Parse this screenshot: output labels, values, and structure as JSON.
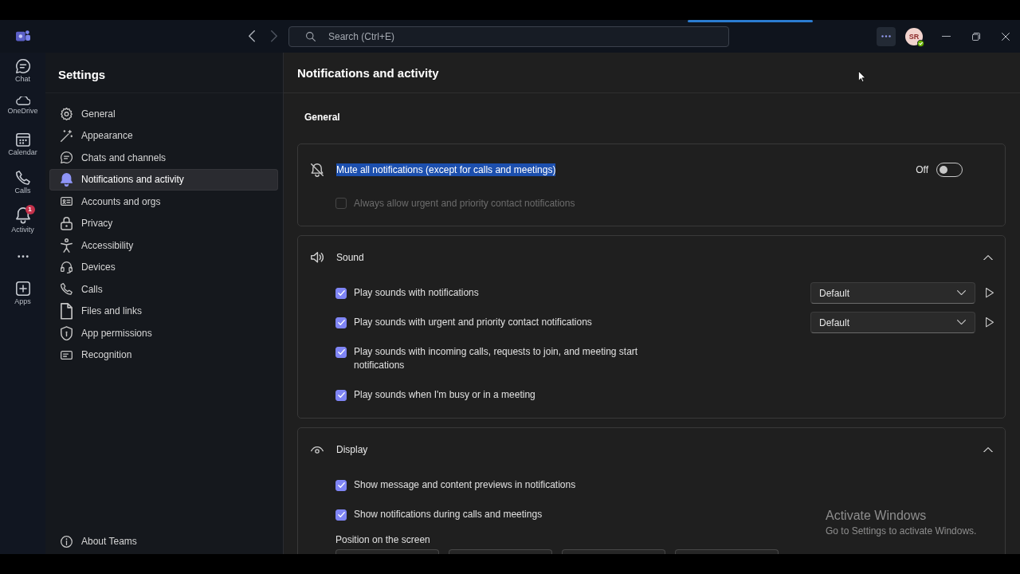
{
  "title_bar": {
    "navigation": {
      "back_disabled": false,
      "forward_disabled": true
    },
    "search": {
      "placeholder": "Search (Ctrl+E)"
    },
    "avatar": {
      "initials": "SR",
      "available": true
    }
  },
  "app_rail": [
    {
      "kind": "app",
      "label": "Chat"
    },
    {
      "kind": "app",
      "label": "OneDrive"
    },
    {
      "kind": "app",
      "label": "Calendar"
    },
    {
      "kind": "app",
      "label": "Calls"
    },
    {
      "kind": "app",
      "label": "Activity",
      "badge": "1"
    },
    {
      "kind": "more"
    },
    {
      "kind": "app",
      "label": "Apps"
    }
  ],
  "settings": {
    "title": "Settings",
    "items": [
      {
        "label": "General",
        "selected": false
      },
      {
        "label": "Appearance",
        "selected": false
      },
      {
        "label": "Chats and channels",
        "selected": false
      },
      {
        "label": "Notifications and activity",
        "selected": true
      },
      {
        "label": "Accounts and orgs",
        "selected": false
      },
      {
        "label": "Privacy",
        "selected": false
      },
      {
        "label": "Accessibility",
        "selected": false
      },
      {
        "label": "Devices",
        "selected": false
      },
      {
        "label": "Calls",
        "selected": false
      },
      {
        "label": "Files and links",
        "selected": false
      },
      {
        "label": "App permissions",
        "selected": false
      },
      {
        "label": "Recognition",
        "selected": false
      }
    ],
    "footer": "About Teams"
  },
  "page": {
    "title": "Notifications and activity",
    "group": "General",
    "sections": [
      {
        "kind": "plain",
        "rows": [
          {
            "kind": "toggle",
            "label": "Mute all notifications (except for calls and meetings)",
            "text_selected": true,
            "state_label": "Off",
            "on": false
          },
          {
            "kind": "checkbox",
            "label": "Always allow urgent and priority contact notifications",
            "checked": false,
            "disabled": true
          }
        ]
      },
      {
        "kind": "collapsible",
        "title": "Sound",
        "expanded": true,
        "rows": [
          {
            "kind": "checkbox",
            "label": "Play sounds with notifications",
            "checked": true,
            "disabled": false,
            "dropdown_value": "Default"
          },
          {
            "kind": "checkbox",
            "label": "Play sounds with urgent and priority contact notifications",
            "checked": true,
            "disabled": false,
            "dropdown_value": "Default"
          },
          {
            "kind": "checkbox",
            "label": "Play sounds with incoming calls, requests to join, and meeting start notifications",
            "checked": true,
            "disabled": false
          },
          {
            "kind": "checkbox",
            "label": "Play sounds when I'm busy or in a meeting",
            "checked": true,
            "disabled": false
          }
        ]
      },
      {
        "kind": "collapsible",
        "title": "Display",
        "expanded": true,
        "rows": [
          {
            "kind": "checkbox",
            "label": "Show message and content previews in notifications",
            "checked": true,
            "disabled": false
          },
          {
            "kind": "checkbox",
            "label": "Show notifications during calls and meetings",
            "checked": true,
            "disabled": false
          },
          {
            "kind": "position_picker",
            "label": "Position on the screen"
          }
        ]
      }
    ]
  },
  "system_overlay": {
    "title": "Activate Windows",
    "subtitle": "Go to Settings to activate Windows."
  }
}
